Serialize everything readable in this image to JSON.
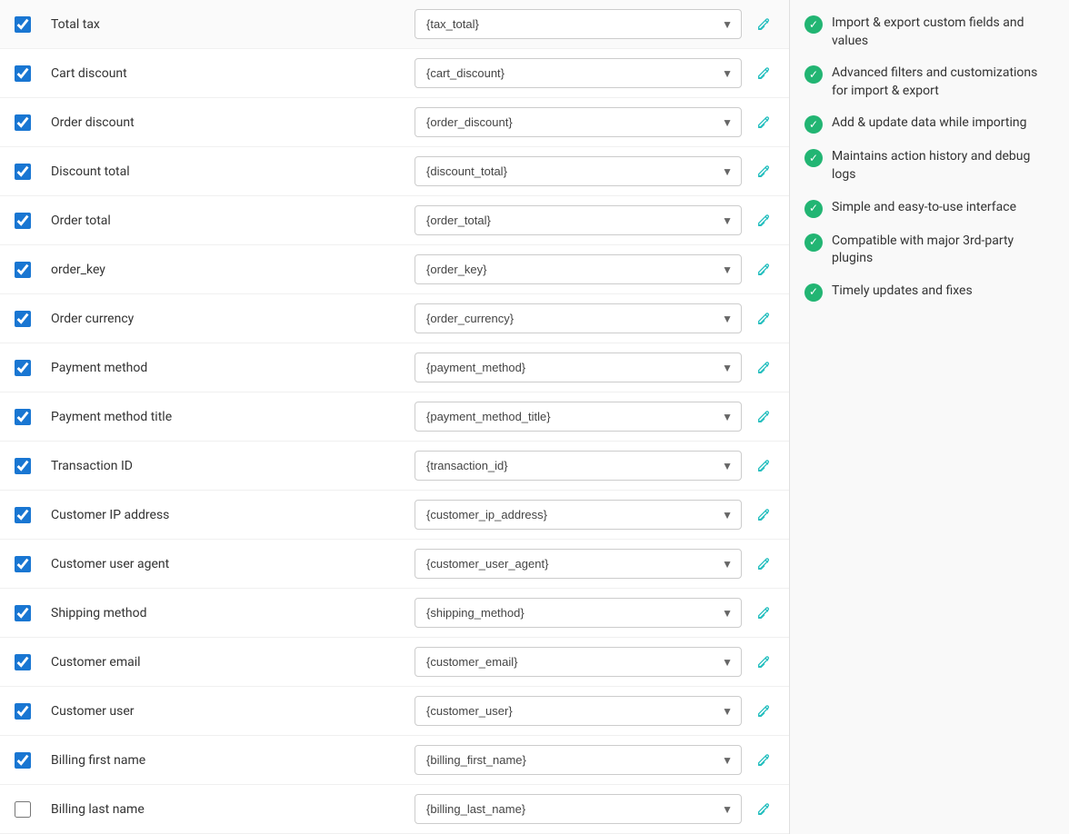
{
  "fields": [
    {
      "label": "Total tax",
      "value": "{tax_total}",
      "checked": true
    },
    {
      "label": "Cart discount",
      "value": "{cart_discount}",
      "checked": true
    },
    {
      "label": "Order discount",
      "value": "{order_discount}",
      "checked": true
    },
    {
      "label": "Discount total",
      "value": "{discount_total}",
      "checked": true
    },
    {
      "label": "Order total",
      "value": "{order_total}",
      "checked": true
    },
    {
      "label": "order_key",
      "value": "{order_key}",
      "checked": true
    },
    {
      "label": "Order currency",
      "value": "{order_currency}",
      "checked": true
    },
    {
      "label": "Payment method",
      "value": "{payment_method}",
      "checked": true
    },
    {
      "label": "Payment method title",
      "value": "{payment_method_title}",
      "checked": true
    },
    {
      "label": "Transaction ID",
      "value": "{transaction_id}",
      "checked": true
    },
    {
      "label": "Customer IP address",
      "value": "{customer_ip_address}",
      "checked": true
    },
    {
      "label": "Customer user agent",
      "value": "{customer_user_agent}",
      "checked": true
    },
    {
      "label": "Shipping method",
      "value": "{shipping_method}",
      "checked": true
    },
    {
      "label": "Customer email",
      "value": "{customer_email}",
      "checked": true
    },
    {
      "label": "Customer user",
      "value": "{customer_user}",
      "checked": true
    },
    {
      "label": "Billing first name",
      "value": "{billing_first_name}",
      "checked": true
    },
    {
      "label": "Billing last name",
      "value": "{billing_last_name}",
      "checked": false
    }
  ],
  "features": [
    {
      "text": "Import & export custom fields and values"
    },
    {
      "text": "Advanced filters and customizations for import & export"
    },
    {
      "text": "Add & update data while importing"
    },
    {
      "text": "Maintains action history and debug logs"
    },
    {
      "text": "Simple and easy-to-use interface"
    },
    {
      "text": "Compatible with major 3rd-party plugins"
    },
    {
      "text": "Timely updates and fixes"
    }
  ]
}
